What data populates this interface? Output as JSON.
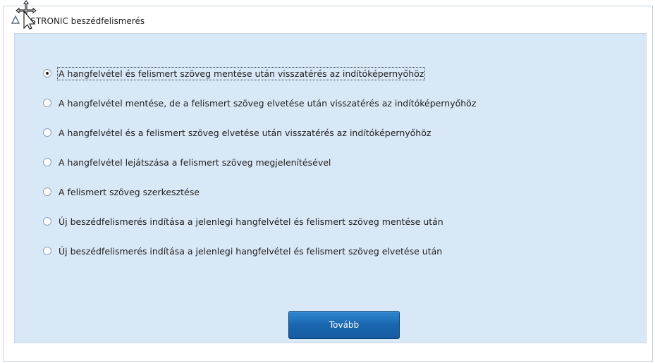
{
  "window": {
    "title": "ASTRONIC beszédfelismerés"
  },
  "options": [
    {
      "label": "A hangfelvétel és felismert szöveg mentése után visszatérés az indítóképernyőhöz",
      "checked": true
    },
    {
      "label": "A hangfelvétel mentése, de a felismert szöveg elvetése után visszatérés az indítóképernyőhöz",
      "checked": false
    },
    {
      "label": "A hangfelvétel és a felismert szöveg elvetése után visszatérés az indítóképernyőhöz",
      "checked": false
    },
    {
      "label": "A hangfelvétel lejátszása a felismert szöveg megjelenítésével",
      "checked": false
    },
    {
      "label": "A felismert szöveg szerkesztése",
      "checked": false
    },
    {
      "label": "Új beszédfelismerés indítása a jelenlegi hangfelvétel és felismert szöveg mentése után",
      "checked": false
    },
    {
      "label": "Új beszédfelismerés indítása a jelenlegi hangfelvétel és felismert szöveg elvetése után",
      "checked": false
    }
  ],
  "buttons": {
    "next_label": "Tovább"
  },
  "colors": {
    "panel_bg": "#d9e8f6",
    "button_blue": "#1b67b0"
  }
}
